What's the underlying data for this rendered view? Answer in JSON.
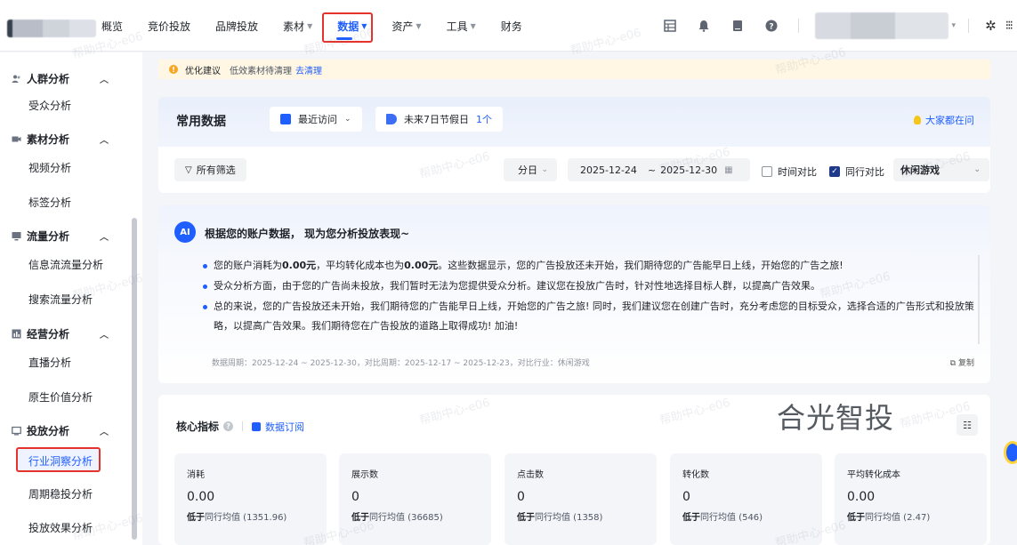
{
  "nav": {
    "items": [
      {
        "label": "概览",
        "caret": false
      },
      {
        "label": "竞价投放",
        "caret": false
      },
      {
        "label": "品牌投放",
        "caret": false
      },
      {
        "label": "素材",
        "caret": true
      },
      {
        "label": "数据",
        "caret": true,
        "active": true
      },
      {
        "label": "资产",
        "caret": true
      },
      {
        "label": "工具",
        "caret": true
      },
      {
        "label": "财务",
        "caret": false
      }
    ],
    "icons": [
      "table-icon",
      "bell-icon",
      "book-icon",
      "help-icon"
    ]
  },
  "sidebar": {
    "groups": [
      {
        "label": "人群分析",
        "icon": "people-icon",
        "items": [
          "受众分析"
        ]
      },
      {
        "label": "素材分析",
        "icon": "video-icon",
        "items": [
          "视频分析",
          "标签分析"
        ]
      },
      {
        "label": "流量分析",
        "icon": "monitor-icon",
        "items": [
          "信息流流量分析",
          "搜索流量分析"
        ]
      },
      {
        "label": "经营分析",
        "icon": "chart-icon",
        "items": [
          "直播分析",
          "原生价值分析"
        ]
      },
      {
        "label": "投放分析",
        "icon": "screen-icon",
        "items": [
          "行业洞察分析",
          "周期稳投分析",
          "投放效果分析"
        ]
      }
    ],
    "active_item": "行业洞察分析"
  },
  "tip": {
    "title": "优化建议",
    "text": "低效素材待清理",
    "link": "去清理"
  },
  "common": {
    "title": "常用数据",
    "recent": "最近访问",
    "holiday_label": "未来7日节假日",
    "holiday_count": "1个",
    "everyone": "大家都在问",
    "filter_all": "所有筛选",
    "granularity": "分日",
    "date_start": "2025-12-24",
    "date_sep": "~",
    "date_end": "2025-12-30",
    "time_compare": "时间对比",
    "peer_compare": "同行对比",
    "industry": "休闲游戏"
  },
  "ai": {
    "badge": "AI",
    "title": "根据您的账户数据， 现为您分析投放表现~",
    "bullets": [
      {
        "pre": "您的账户消耗为",
        "b1": "0.00元",
        "mid": "，平均转化成本也为",
        "b2": "0.00元",
        "post": "。这些数据显示，您的广告投放还未开始，我们期待您的广告能早日上线，开始您的广告之旅!"
      },
      {
        "pre": "受众分析方面，由于您的广告尚未投放，我们暂时无法为您提供受众分析。建议您在投放广告时，针对性地选择目标人群，以提高广告效果。",
        "b1": "",
        "mid": "",
        "b2": "",
        "post": ""
      },
      {
        "pre": "总的来说，您的广告投放还未开始，我们期待您的广告能早日上线，开始您的广告之旅! 同时，我们建议您在创建广告时，充分考虑您的目标受众，选择合适的广告形式和投放策略，以提高广告效果。我们期待您在广告投放的道路上取得成功! 加油!",
        "b1": "",
        "mid": "",
        "b2": "",
        "post": ""
      }
    ],
    "footer": "数据周期：2025-12-24 ~ 2025-12-30，对比周期：2025-12-17 ~ 2025-12-23，对比行业：休闲游戏",
    "copy": "复制"
  },
  "core": {
    "title": "核心指标",
    "subscribe": "数据订阅",
    "brand_watermark": "合光智投",
    "metrics": [
      {
        "label": "消耗",
        "value": "0.00",
        "cmp_bold": "低于",
        "cmp": "同行均值 (1351.96)"
      },
      {
        "label": "展示数",
        "value": "0",
        "cmp_bold": "低于",
        "cmp": "同行均值 (36685)"
      },
      {
        "label": "点击数",
        "value": "0",
        "cmp_bold": "低于",
        "cmp": "同行均值 (1358)"
      },
      {
        "label": "转化数",
        "value": "0",
        "cmp_bold": "低于",
        "cmp": "同行均值 (546)"
      },
      {
        "label": "平均转化成本",
        "value": "0.00",
        "cmp_bold": "低于",
        "cmp": "同行均值 (2.47)"
      }
    ]
  },
  "watermark_text": "帮助中心-e06",
  "colors": {
    "accent": "#1f5eff",
    "highlight": "#e5322d",
    "tip_bg": "#fff7e3"
  }
}
